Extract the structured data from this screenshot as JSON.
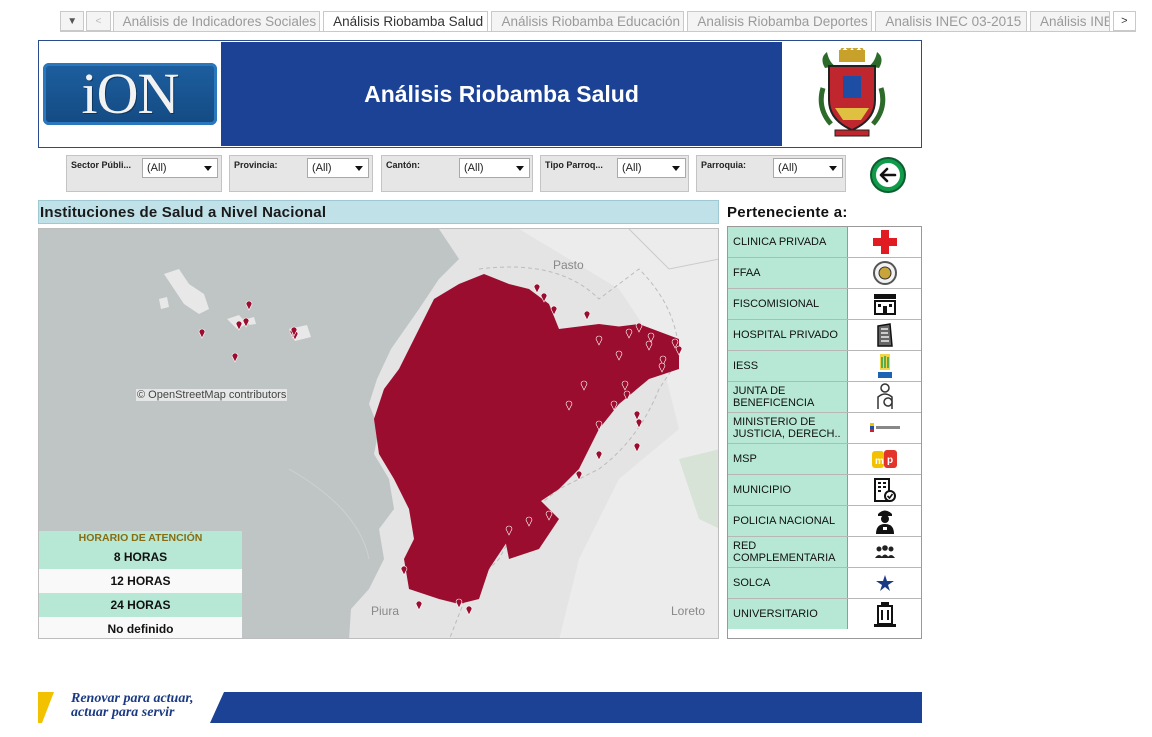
{
  "tabs": {
    "items": [
      {
        "label": "Análisis de Indicadores Sociales",
        "active": false
      },
      {
        "label": "Análisis Riobamba Salud",
        "active": true
      },
      {
        "label": "Análisis Riobamba Educación",
        "active": false
      },
      {
        "label": "Analisis Riobamba Deportes",
        "active": false
      },
      {
        "label": "Analisis INEC 03-2015",
        "active": false
      },
      {
        "label": "Análisis INE",
        "active": false
      }
    ]
  },
  "header": {
    "logo_text": "iON",
    "title": "Análisis Riobamba Salud"
  },
  "filters": [
    {
      "label": "Sector Públi...",
      "value": "(All)"
    },
    {
      "label": "Provincia:",
      "value": "(All)"
    },
    {
      "label": "Cantón:",
      "value": "(All)"
    },
    {
      "label": "Tipo Parroq...",
      "value": "(All)"
    },
    {
      "label": "Parroquia:",
      "value": "(All)"
    }
  ],
  "map": {
    "title": "Instituciones de Salud a Nivel Nacional",
    "attribution": "© OpenStreetMap contributors",
    "places": [
      "Pasto",
      "Piura",
      "Loreto"
    ],
    "marker_color": "#9b0d2e",
    "legend": {
      "title": "HORARIO DE ATENCIÓN",
      "items": [
        "8 HORAS",
        "12 HORAS",
        "24 HORAS",
        "No definido"
      ]
    }
  },
  "institutions": {
    "title": "Perteneciente a:",
    "items": [
      {
        "label": "CLINICA PRIVADA",
        "icon": "red-cross-icon"
      },
      {
        "label": "FFAA",
        "icon": "ffaa-seal-icon"
      },
      {
        "label": "FISCOMISIONAL",
        "icon": "school-building-icon"
      },
      {
        "label": "HOSPITAL PRIVADO",
        "icon": "office-building-icon"
      },
      {
        "label": "IESS",
        "icon": "iess-logo-icon"
      },
      {
        "label": "JUNTA DE BENEFICENCIA",
        "icon": "person-badge-icon"
      },
      {
        "label": "MINISTERIO DE JUSTICIA,  DERECH..",
        "icon": "ministry-flag-icon"
      },
      {
        "label": "MSP",
        "icon": "msp-logo-icon"
      },
      {
        "label": "MUNICIPIO",
        "icon": "building-check-icon"
      },
      {
        "label": "POLICIA NACIONAL",
        "icon": "police-officer-icon"
      },
      {
        "label": "RED COMPLEMENTARIA",
        "icon": "people-group-icon"
      },
      {
        "label": "SOLCA",
        "icon": "solca-emblem-icon"
      },
      {
        "label": "UNIVERSITARIO",
        "icon": "university-building-icon"
      }
    ]
  },
  "footer": {
    "slogan_line1": "Renovar para actuar,",
    "slogan_line2": "actuar para servir",
    "band_color": "#1b4294",
    "accent_color": "#f2c200"
  }
}
